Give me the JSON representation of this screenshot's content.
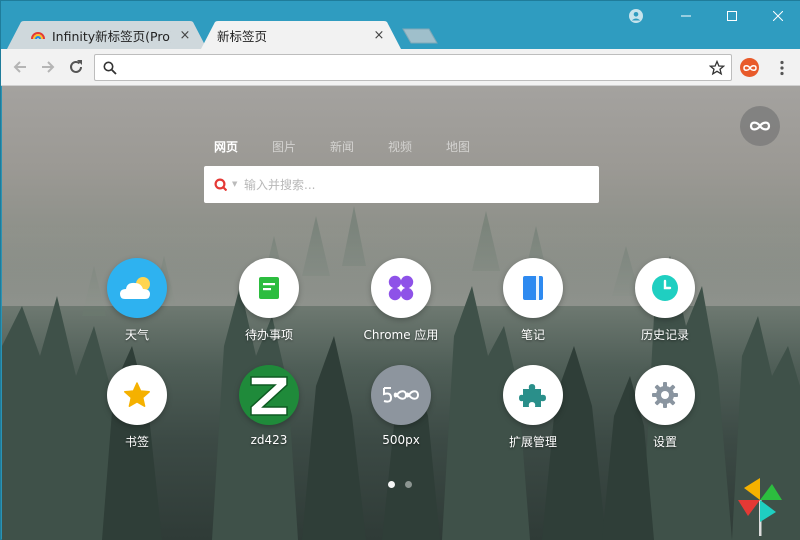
{
  "tabs": [
    {
      "title": "Infinity新标签页(Pro) - C",
      "close": "×"
    },
    {
      "title": "新标签页",
      "close": "×"
    }
  ],
  "omnibox": {
    "value": "",
    "placeholder": ""
  },
  "search": {
    "tabs": [
      "网页",
      "图片",
      "新闻",
      "视频",
      "地图"
    ],
    "active_tab": "网页",
    "placeholder": "输入并搜索..."
  },
  "tiles": [
    {
      "label": "天气",
      "icon": "weather-icon"
    },
    {
      "label": "待办事项",
      "icon": "todo-icon"
    },
    {
      "label": "Chrome 应用",
      "icon": "chrome-apps-icon"
    },
    {
      "label": "笔记",
      "icon": "notes-icon"
    },
    {
      "label": "历史记录",
      "icon": "history-icon"
    },
    {
      "label": "书签",
      "icon": "bookmark-star-icon"
    },
    {
      "label": "zd423",
      "icon": "zd423-logo-icon"
    },
    {
      "label": "500px",
      "icon": "500px-logo-icon"
    },
    {
      "label": "扩展管理",
      "icon": "puzzle-icon"
    },
    {
      "label": "设置",
      "icon": "gear-icon"
    }
  ],
  "pagination": {
    "pages": 2,
    "current": 1
  },
  "colors": {
    "tabstrip": "#2f9cc0",
    "weather": "#2eb2f0",
    "todo": "#2cbd3f",
    "chrome_apps": "#8e52e8",
    "notes": "#2e8af0",
    "history": "#1fcfc1",
    "star": "#f5b100",
    "zd423": "#1f8a3a",
    "px500": "#8d959e",
    "puzzle": "#2a8f8a",
    "gear": "#8a95a0"
  }
}
